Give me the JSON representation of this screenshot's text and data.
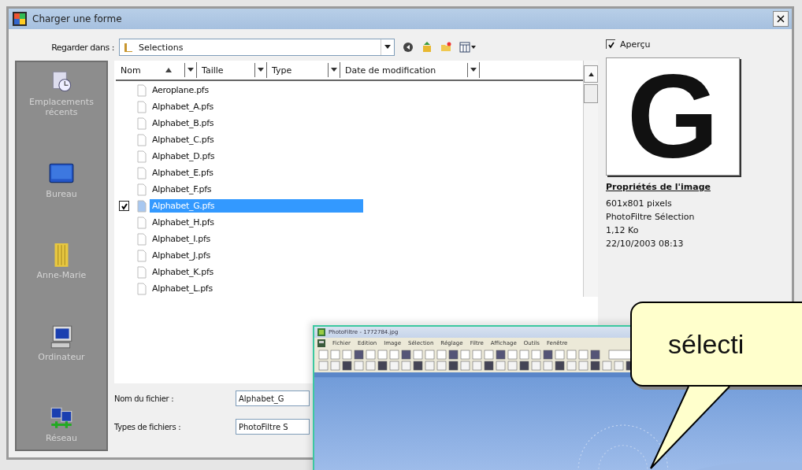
{
  "window": {
    "title": "Charger une forme",
    "close": "×"
  },
  "look_in": {
    "label": "Regarder dans :",
    "value": "Selections"
  },
  "preview_toggle": {
    "label": "Aperçu",
    "checked": true
  },
  "places": [
    {
      "label": "Emplacements récents",
      "kind": "recent"
    },
    {
      "label": "Bureau",
      "kind": "desktop"
    },
    {
      "label": "Anne-Marie",
      "kind": "user"
    },
    {
      "label": "Ordinateur",
      "kind": "computer"
    },
    {
      "label": "Réseau",
      "kind": "network"
    }
  ],
  "columns": [
    {
      "label": "Nom",
      "sorted": true
    },
    {
      "label": "Taille",
      "sorted": false
    },
    {
      "label": "Type",
      "sorted": false
    },
    {
      "label": "Date de modification",
      "sorted": false
    }
  ],
  "files": [
    {
      "name": "Aeroplane.pfs",
      "selected": false
    },
    {
      "name": "Alphabet_A.pfs",
      "selected": false
    },
    {
      "name": "Alphabet_B.pfs",
      "selected": false
    },
    {
      "name": "Alphabet_C.pfs",
      "selected": false
    },
    {
      "name": "Alphabet_D.pfs",
      "selected": false
    },
    {
      "name": "Alphabet_E.pfs",
      "selected": false
    },
    {
      "name": "Alphabet_F.pfs",
      "selected": false
    },
    {
      "name": "Alphabet_G.pfs",
      "selected": true
    },
    {
      "name": "Alphabet_H.pfs",
      "selected": false
    },
    {
      "name": "Alphabet_I.pfs",
      "selected": false
    },
    {
      "name": "Alphabet_J.pfs",
      "selected": false
    },
    {
      "name": "Alphabet_K.pfs",
      "selected": false
    },
    {
      "name": "Alphabet_L.pfs",
      "selected": false
    }
  ],
  "file_name": {
    "label": "Nom du fichier :",
    "value": "Alphabet_G"
  },
  "file_type": {
    "label": "Types de fichiers :",
    "value": "PhotoFiltre S"
  },
  "preview": {
    "glyph": "G"
  },
  "properties": {
    "title": "Propriétés de l'image",
    "lines": [
      "601x801 pixels",
      "PhotoFiltre Sélection",
      "1,12 Ko",
      "22/10/2003 08:13"
    ]
  },
  "photofiltre": {
    "title": "PhotoFiltre - 1772784.jpg",
    "menu": [
      "Fichier",
      "Edition",
      "Image",
      "Sélection",
      "Réglage",
      "Filtre",
      "Affichage",
      "Outils",
      "Fenêtre"
    ]
  },
  "callout": {
    "text": "sélecti"
  }
}
